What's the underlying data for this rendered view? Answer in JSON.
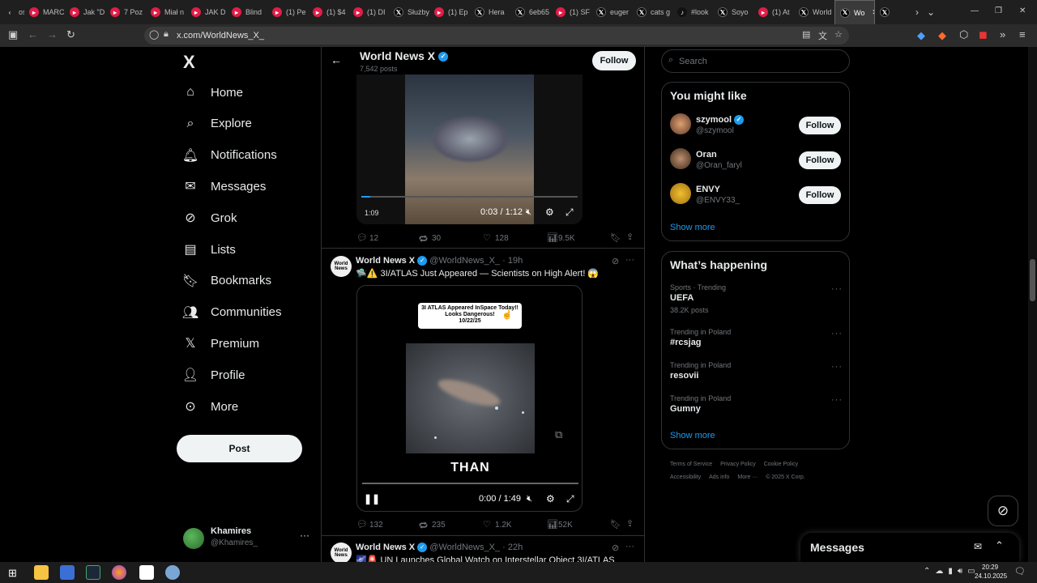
{
  "browser": {
    "tabs": [
      {
        "label": "ośk",
        "icon": "chevron"
      },
      {
        "label": "MARC",
        "icon": "youtube"
      },
      {
        "label": "Jak \"D",
        "icon": "youtube"
      },
      {
        "label": "7 Poz",
        "icon": "youtube"
      },
      {
        "label": "Miał n",
        "icon": "youtube"
      },
      {
        "label": "JAK D",
        "icon": "youtube"
      },
      {
        "label": "Blind",
        "icon": "youtube"
      },
      {
        "label": "(1) Pe",
        "icon": "youtube"
      },
      {
        "label": "(1) $4",
        "icon": "youtube"
      },
      {
        "label": "(1) DI",
        "icon": "youtube"
      },
      {
        "label": "Służby",
        "icon": "x"
      },
      {
        "label": "(1) Ep",
        "icon": "youtube"
      },
      {
        "label": "Hera",
        "icon": "x"
      },
      {
        "label": "6eb65",
        "icon": "x"
      },
      {
        "label": "(1) SF",
        "icon": "youtube"
      },
      {
        "label": "euger",
        "icon": "x"
      },
      {
        "label": "cats g",
        "icon": "x"
      },
      {
        "label": "#look",
        "icon": "tiktok"
      },
      {
        "label": "Soyo",
        "icon": "x"
      },
      {
        "label": "(1) At",
        "icon": "youtube"
      },
      {
        "label": "World",
        "icon": "x"
      },
      {
        "label": "Wo",
        "icon": "x",
        "active": true
      },
      {
        "label": "",
        "icon": "x"
      }
    ],
    "url": "x.com/WorldNews_X_"
  },
  "sidebar": {
    "logo": "X",
    "items": [
      {
        "label": "Home",
        "icon": "home-icon"
      },
      {
        "label": "Explore",
        "icon": "search-icon"
      },
      {
        "label": "Notifications",
        "icon": "bell-icon"
      },
      {
        "label": "Messages",
        "icon": "mail-icon"
      },
      {
        "label": "Grok",
        "icon": "grok-icon"
      },
      {
        "label": "Lists",
        "icon": "list-icon"
      },
      {
        "label": "Bookmarks",
        "icon": "bookmark-icon"
      },
      {
        "label": "Communities",
        "icon": "people-icon"
      },
      {
        "label": "Premium",
        "icon": "x-icon"
      },
      {
        "label": "Profile",
        "icon": "person-icon"
      },
      {
        "label": "More",
        "icon": "more-circle-icon"
      }
    ],
    "post_label": "Post",
    "account": {
      "name": "Khamires",
      "handle": "@Khamires_"
    }
  },
  "header": {
    "name": "World News X",
    "posts": "7,542 posts",
    "follow_label": "Follow"
  },
  "video1": {
    "elapsed": "1:09",
    "time": "0:03 / 1:12"
  },
  "tweet1_actions": {
    "replies": "12",
    "reposts": "30",
    "likes": "128",
    "views": "9.5K"
  },
  "tweet2": {
    "name": "World News X",
    "handle": "@WorldNews_X_",
    "time": "· 19h",
    "text": "🛸⚠️ 3I/ATLAS Just Appeared — Scientists on High Alert! 😱",
    "overlay_line1": "3I ATLAS Appeared InSpace Today!!",
    "overlay_line2": "Looks Dangerous!",
    "overlay_date": "10/22/25",
    "caption": "THAN",
    "time_display": "0:00 / 1:49",
    "actions": {
      "replies": "132",
      "reposts": "235",
      "likes": "1.2K",
      "views": "52K"
    }
  },
  "tweet3": {
    "name": "World News X",
    "handle": "@WorldNews_X_",
    "time": "· 22h",
    "text": "🌌🚨 UN Launches Global Watch on Interstellar Object 3I/ATLAS"
  },
  "right": {
    "search_placeholder": "Search",
    "you_might_like": "You might like",
    "suggestions": [
      {
        "name": "szymool",
        "handle": "@szymool",
        "verified": true,
        "follow": "Follow"
      },
      {
        "name": "Oran",
        "handle": "@Oran_faryl",
        "verified": false,
        "follow": "Follow"
      },
      {
        "name": "ENVY",
        "handle": "@ENVY33_",
        "verified": false,
        "follow": "Follow"
      }
    ],
    "show_more": "Show more",
    "whats_happening": "What’s happening",
    "trends": [
      {
        "meta": "Sports · Trending",
        "name": "UEFA",
        "count": "38.2K posts"
      },
      {
        "meta": "Trending in Poland",
        "name": "#rcsjag",
        "count": ""
      },
      {
        "meta": "Trending in Poland",
        "name": "resovii",
        "count": ""
      },
      {
        "meta": "Trending in Poland",
        "name": "Gumny",
        "count": ""
      }
    ],
    "show_more2": "Show more",
    "footer_line1": [
      "Terms of Service",
      "Privacy Policy",
      "Cookie Policy"
    ],
    "footer_line2": [
      "Accessibility",
      "Ads info",
      "More ···",
      "© 2025 X Corp."
    ],
    "messages_label": "Messages"
  },
  "taskbar": {
    "time": "20:29",
    "date": "24.10.2025"
  }
}
